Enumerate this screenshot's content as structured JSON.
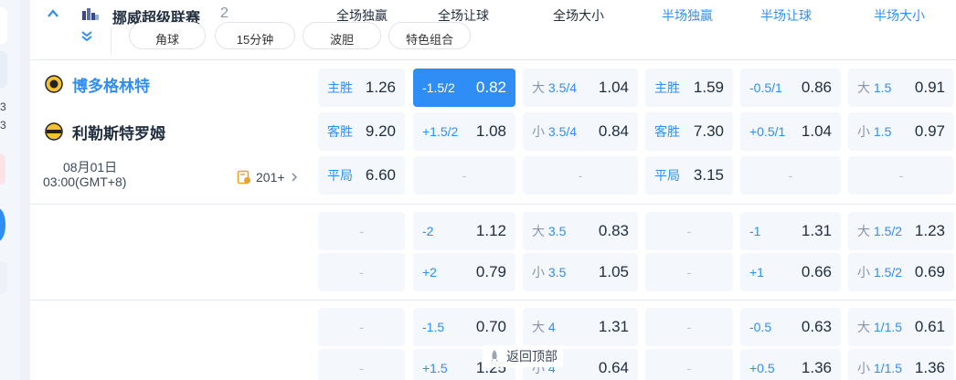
{
  "sidebar": {
    "nums": [
      "3",
      "3"
    ]
  },
  "league": {
    "name": "挪威超级联赛",
    "count": "2"
  },
  "columns": [
    "全场独赢",
    "全场让球",
    "全场大小",
    "半场独赢",
    "半场让球",
    "半场大小"
  ],
  "filters": [
    "角球",
    "15分钟",
    "波胆",
    "特色组合"
  ],
  "match": {
    "home": "博多格林特",
    "away": "利勒斯特罗姆",
    "date": "08月01日",
    "time": "03:00(GMT+8)",
    "more": "201+"
  },
  "row1": {
    "home": {
      "fw_l": "主胜",
      "fw_v": "1.26",
      "fh_l": "-1.5/2",
      "fh_v": "0.82",
      "fo_p": "大",
      "fo_l": "3.5/4",
      "fo_v": "1.04",
      "hw_l": "主胜",
      "hw_v": "1.59",
      "hh_l": "-0.5/1",
      "hh_v": "0.86",
      "ho_p": "大",
      "ho_l": "1.5",
      "ho_v": "0.91"
    },
    "away": {
      "fw_l": "客胜",
      "fw_v": "9.20",
      "fh_l": "+1.5/2",
      "fh_v": "1.08",
      "fo_p": "小",
      "fo_l": "3.5/4",
      "fo_v": "0.84",
      "hw_l": "客胜",
      "hw_v": "7.30",
      "hh_l": "+0.5/1",
      "hh_v": "1.04",
      "ho_p": "小",
      "ho_l": "1.5",
      "ho_v": "0.97"
    },
    "draw": {
      "fw_l": "平局",
      "fw_v": "6.60",
      "hw_l": "平局",
      "hw_v": "3.15"
    }
  },
  "row2": {
    "a": {
      "fh_l": "-2",
      "fh_v": "1.12",
      "fo_p": "大",
      "fo_l": "3.5",
      "fo_v": "0.83",
      "hh_l": "-1",
      "hh_v": "1.31",
      "ho_p": "大",
      "ho_l": "1.5/2",
      "ho_v": "1.23"
    },
    "b": {
      "fh_l": "+2",
      "fh_v": "0.79",
      "fo_p": "小",
      "fo_l": "3.5",
      "fo_v": "1.05",
      "hh_l": "+1",
      "hh_v": "0.66",
      "ho_p": "小",
      "ho_l": "1.5/2",
      "ho_v": "0.69"
    }
  },
  "row3": {
    "a": {
      "fh_l": "-1.5",
      "fh_v": "0.70",
      "fo_p": "大",
      "fo_l": "4",
      "fo_v": "1.31",
      "hh_l": "-0.5",
      "hh_v": "0.63",
      "ho_p": "大",
      "ho_l": "1/1.5",
      "ho_v": "0.61"
    },
    "b": {
      "fh_l": "+1.5",
      "fh_v": "1.25",
      "fo_p": "小",
      "fo_l": "4",
      "fo_v": "0.64",
      "hh_l": "+0.5",
      "hh_v": "1.36",
      "ho_p": "小",
      "ho_l": "1/1.5",
      "ho_v": "1.36"
    }
  },
  "empty": "-",
  "back_to_top": "返回顶部",
  "colors": {
    "accent": "#2f8ef6",
    "cell_bg": "#f4f7fc",
    "text": "#1f2d3d",
    "muted": "#8795a8"
  }
}
